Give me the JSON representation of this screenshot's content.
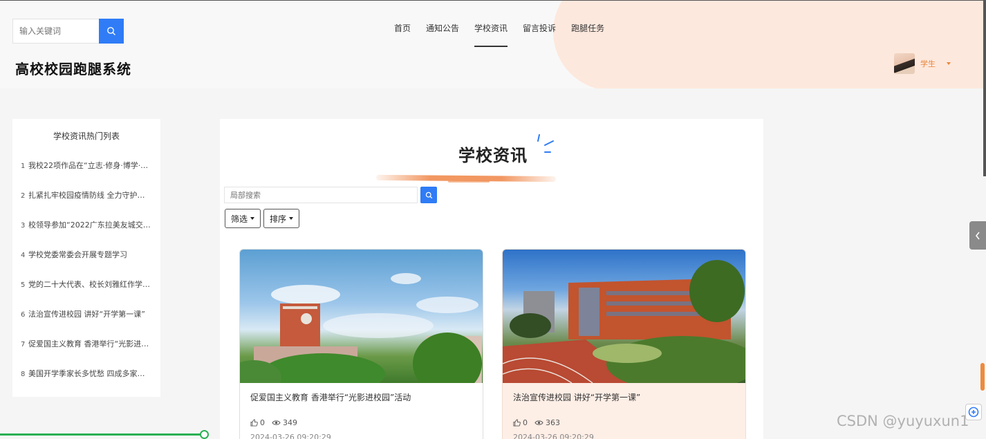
{
  "header": {
    "search_placeholder": "输入关键词",
    "site_title": "高校校园跑腿系统",
    "nav": [
      {
        "label": "首页",
        "active": false
      },
      {
        "label": "通知公告",
        "active": false
      },
      {
        "label": "学校资讯",
        "active": true
      },
      {
        "label": "留言投诉",
        "active": false
      },
      {
        "label": "跑腿任务",
        "active": false
      }
    ],
    "user": {
      "name": "学生"
    }
  },
  "sidebar": {
    "title": "学校资讯热门列表",
    "items": [
      {
        "num": "1",
        "text": "我校22项作品在“立志·修身·博学·…"
      },
      {
        "num": "2",
        "text": "扎紧扎牢校园疫情防线 全力守护…"
      },
      {
        "num": "3",
        "text": "校领导参加“2022广东拉美友城交…"
      },
      {
        "num": "4",
        "text": "学校党委常委会开展专题学习"
      },
      {
        "num": "5",
        "text": "党的二十大代表、校长刘雅红作学…"
      },
      {
        "num": "6",
        "text": "法治宣传进校园 讲好“开学第一课”"
      },
      {
        "num": "7",
        "text": "促爱国主义教育 香港举行“光影进…"
      },
      {
        "num": "8",
        "text": "美国开学季家长多忧愁 四成多家…"
      }
    ]
  },
  "main": {
    "title": "学校资讯",
    "search_placeholder": "局部搜索",
    "filter_label": "筛选",
    "sort_label": "排序",
    "cards": [
      {
        "title": "促爱国主义教育 香港举行“光影进校园”活动",
        "likes": "0",
        "views": "349",
        "date": "2024-03-26 09:20:29"
      },
      {
        "title": "法治宣传进校园 讲好“开学第一课”",
        "likes": "0",
        "views": "363",
        "date": "2024-03-26 09:20:29"
      }
    ]
  },
  "watermark": "CSDN @yuyuxun1",
  "colors": {
    "accent": "#2f7cf6",
    "orange": "#e8863a",
    "header_blob": "#fde8dd",
    "progress": "#2ab054"
  }
}
